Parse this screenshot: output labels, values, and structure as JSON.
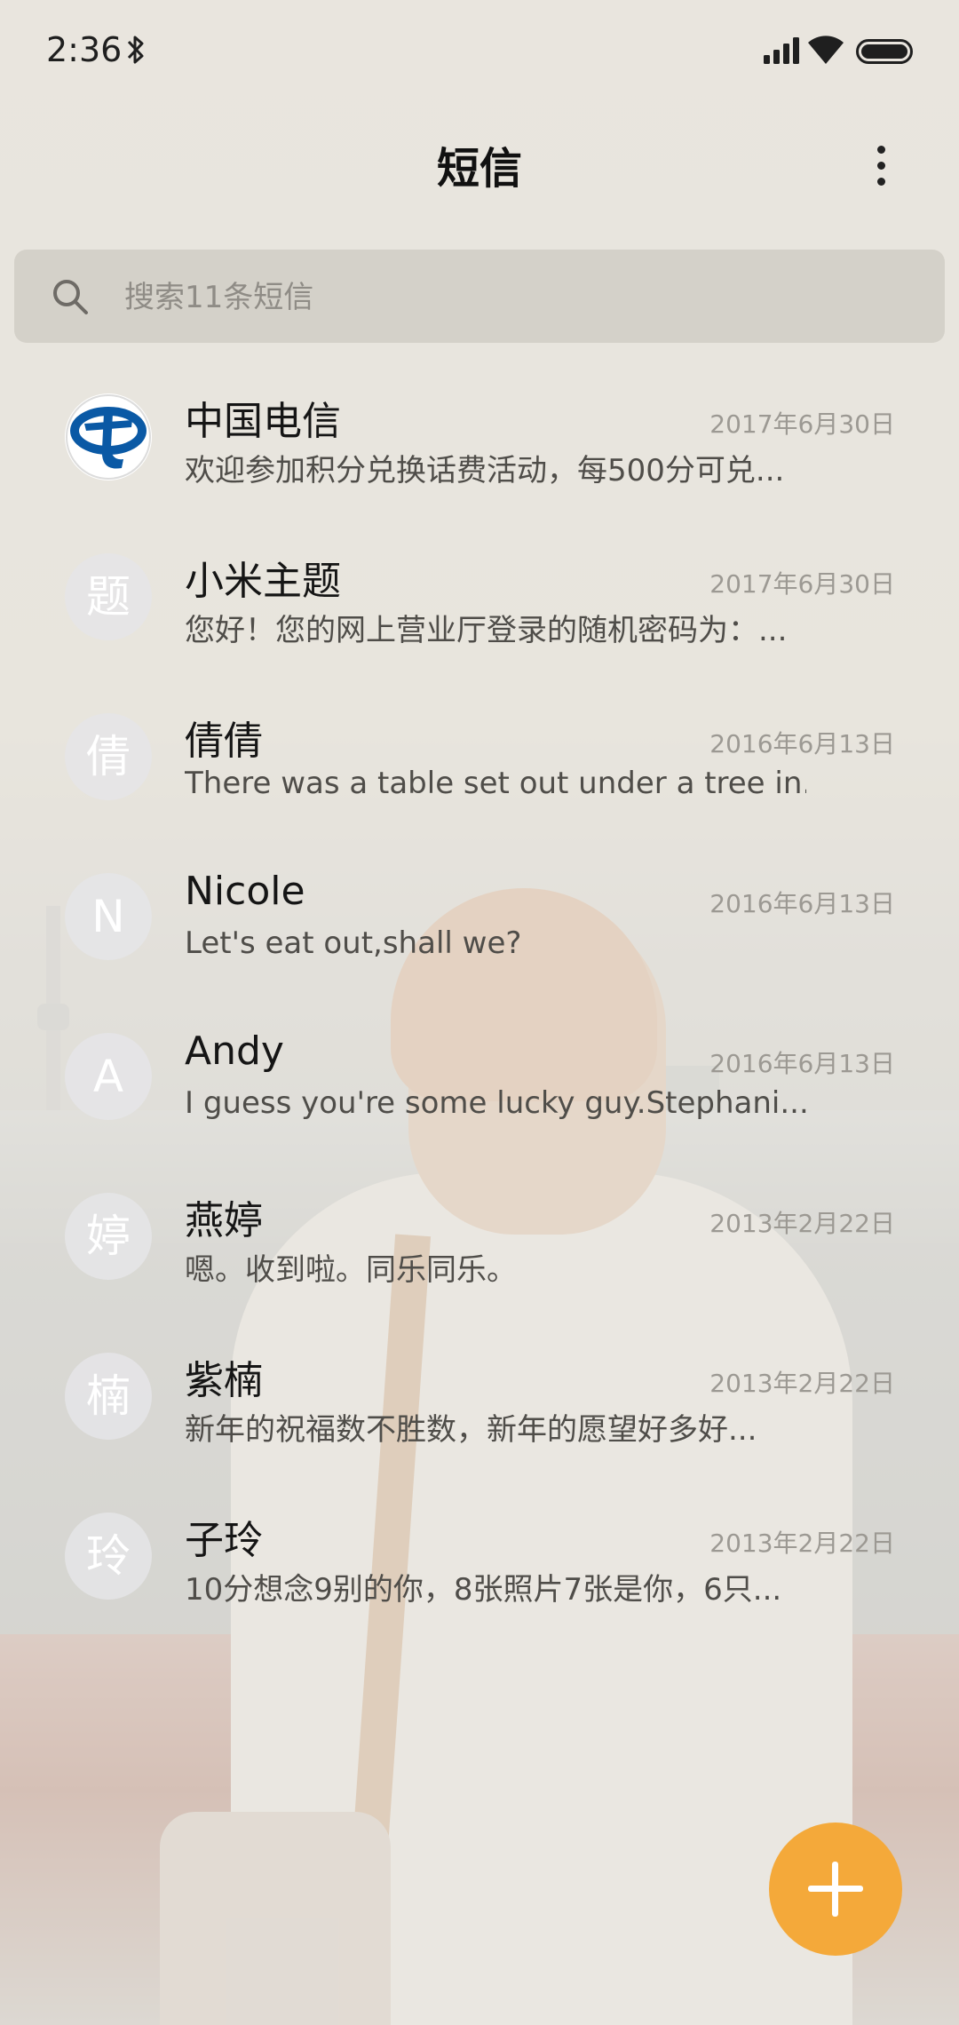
{
  "status_bar": {
    "time": "2:36"
  },
  "header": {
    "title": "短信"
  },
  "search": {
    "placeholder": "搜索11条短信"
  },
  "conversations": [
    {
      "name": "中国电信",
      "date": "2017年6月30日",
      "preview": "欢迎参加积分兑换话费活动，每500分可兑...",
      "avatar": "",
      "avatar_icon": "china-telecom-logo-icon"
    },
    {
      "name": "小米主题",
      "date": "2017年6月30日",
      "preview": "您好！您的网上营业厅登录的随机密码为：...",
      "avatar": "题"
    },
    {
      "name": "倩倩",
      "date": "2016年6月13日",
      "preview": "There was a table set out under a tree in...",
      "avatar": "倩"
    },
    {
      "name": "Nicole",
      "date": "2016年6月13日",
      "preview": "Let's eat out,shall we?",
      "avatar": "N"
    },
    {
      "name": "Andy",
      "date": "2016年6月13日",
      "preview": "I guess you're some lucky guy.Stephani...",
      "avatar": "A"
    },
    {
      "name": "燕婷",
      "date": "2013年2月22日",
      "preview": "嗯。收到啦。同乐同乐。",
      "avatar": "婷"
    },
    {
      "name": "紫楠",
      "date": "2013年2月22日",
      "preview": "新年的祝福数不胜数，新年的愿望好多好...",
      "avatar": "楠"
    },
    {
      "name": "子玲",
      "date": "2013年2月22日",
      "preview": "10分想念9别的你，8张照片7张是你，6只...",
      "avatar": "玲"
    }
  ],
  "colors": {
    "accent": "#f4a93a",
    "telecom_blue": "#0a59a5"
  }
}
